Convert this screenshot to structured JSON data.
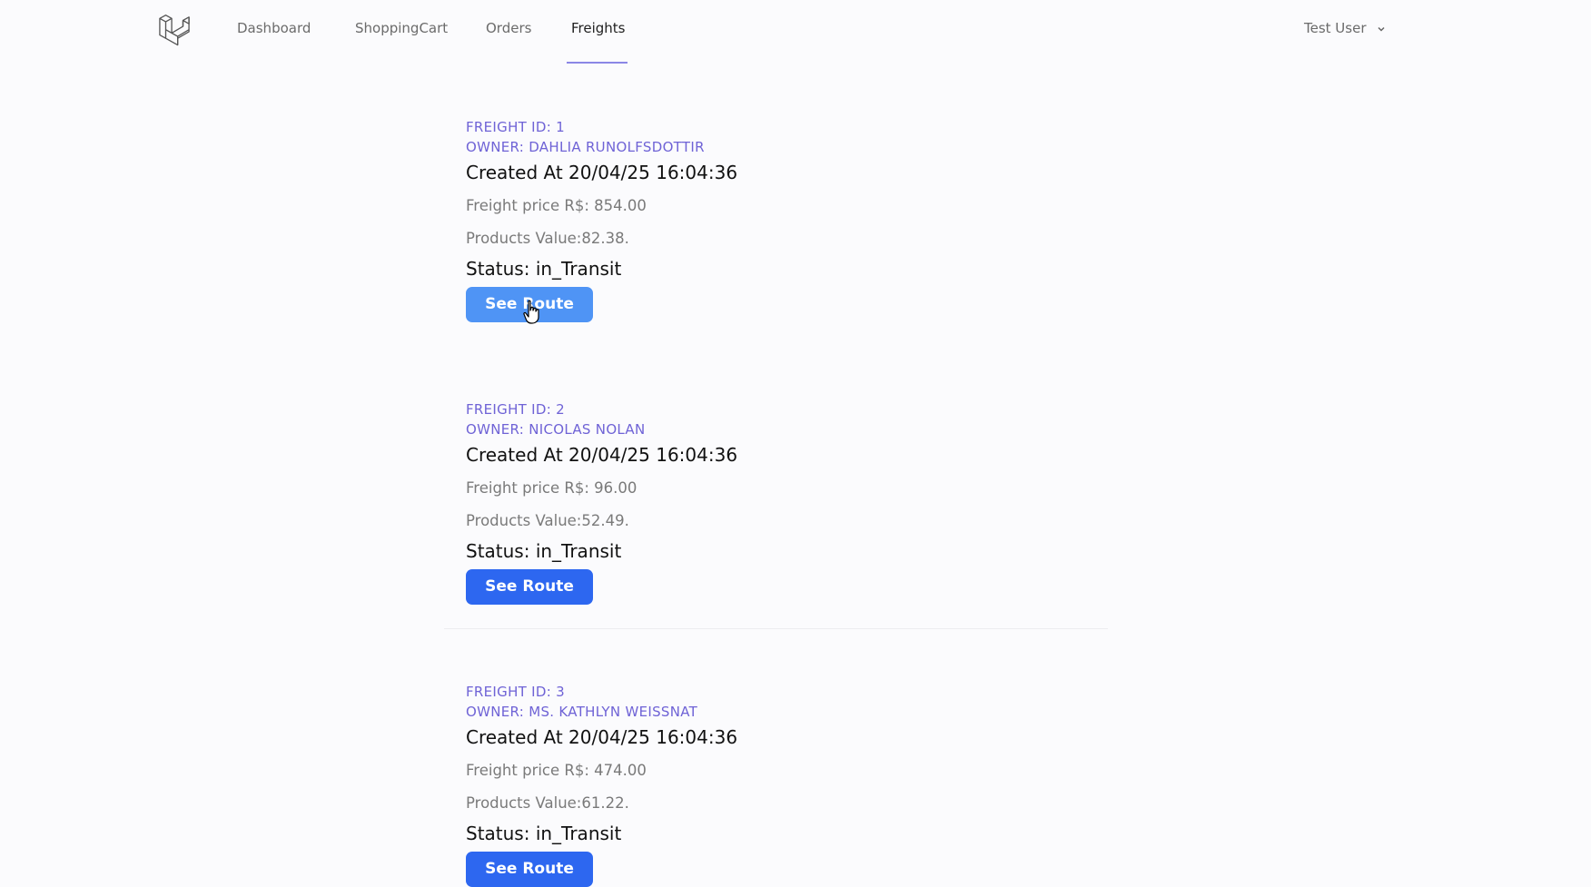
{
  "nav": {
    "logo_icon": "laravel-logo-icon",
    "links": [
      {
        "label": "Dashboard",
        "active": false
      },
      {
        "label": "ShoppingCart",
        "active": false
      },
      {
        "label": "Orders",
        "active": false
      },
      {
        "label": "Freights",
        "active": true
      }
    ],
    "user_name": "Test User",
    "user_icon": "chevron-down-icon"
  },
  "freights": [
    {
      "id_label": "FREIGHT ID: 1",
      "owner_label": "OWNER: DAHLIA RUNOLFSDOTTIR",
      "created": "Created At 20/04/25 16:04:36",
      "price": "Freight price R$: 854.00",
      "products": "Products Value:82.38.",
      "status": "Status: in_Transit",
      "button": "See Route"
    },
    {
      "id_label": "FREIGHT ID: 2",
      "owner_label": "OWNER: NICOLAS NOLAN",
      "created": "Created At 20/04/25 16:04:36",
      "price": "Freight price R$: 96.00",
      "products": "Products Value:52.49.",
      "status": "Status: in_Transit",
      "button": "See Route"
    },
    {
      "id_label": "FREIGHT ID: 3",
      "owner_label": "OWNER: MS. KATHLYN WEISSNAT",
      "created": "Created At 20/04/25 16:04:36",
      "price": "Freight price R$: 474.00",
      "products": "Products Value:61.22.",
      "status": "Status: in_Transit",
      "button": "See Route"
    }
  ],
  "colors": {
    "accent": "#6f63d6",
    "button": "#2d67f0",
    "button_hover": "#4f94f5",
    "nav_underline": "#8b87e6"
  }
}
